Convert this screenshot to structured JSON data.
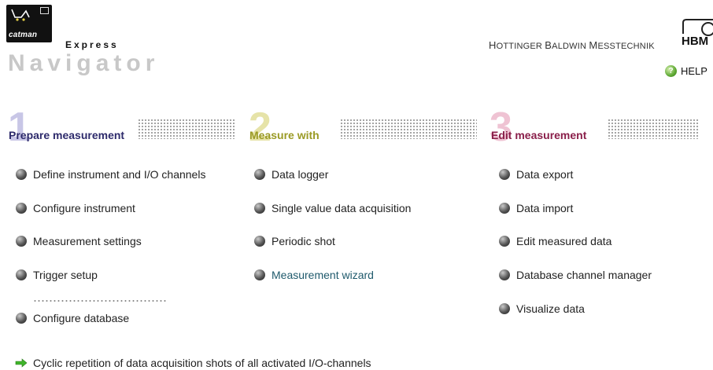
{
  "header": {
    "logo_text": "catman",
    "edition": "Express",
    "title": "Navigator",
    "company_parts": [
      {
        "cap": "H",
        "rest": "OTTINGER"
      },
      {
        "cap": "B",
        "rest": "ALDWIN"
      },
      {
        "cap": "M",
        "rest": "ESSTECHNIK"
      }
    ],
    "brand": "HBM",
    "help_label": "HELP"
  },
  "colors": {
    "section1": "#2d2a6b",
    "section2": "#9a9a24",
    "section3": "#8a1f4a",
    "link": "#1f5a6c"
  },
  "sections": [
    {
      "number": "1",
      "title": "Prepare measurement",
      "items": [
        "Define instrument and I/O channels",
        "Configure instrument",
        "Measurement settings",
        "Trigger setup",
        "Configure database"
      ]
    },
    {
      "number": "2",
      "title": "Measure with",
      "items": [
        "Data logger",
        "Single value data acquisition",
        "Periodic shot",
        "Measurement wizard"
      ]
    },
    {
      "number": "3",
      "title": "Edit measurement",
      "items": [
        "Data export",
        "Data import",
        "Edit measured data",
        "Database channel manager",
        "Visualize data"
      ]
    }
  ],
  "footer_link": "Cyclic repetition of data acquisition shots of all activated I/O-channels"
}
